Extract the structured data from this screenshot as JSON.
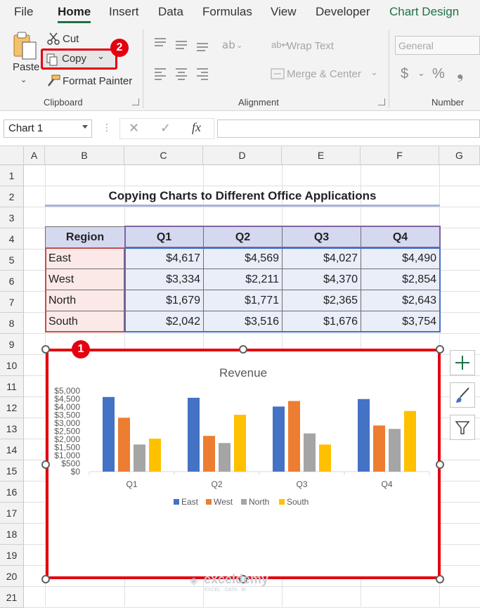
{
  "tabs": [
    "File",
    "Home",
    "Insert",
    "Data",
    "Formulas",
    "View",
    "Developer",
    "Chart Design"
  ],
  "clipboard": {
    "paste": "Paste",
    "cut": "Cut",
    "copy": "Copy",
    "format_painter": "Format Painter",
    "group_label": "Clipboard"
  },
  "alignment": {
    "wrap_text": "Wrap Text",
    "merge_center": "Merge & Center",
    "group_label": "Alignment"
  },
  "number": {
    "format": "General",
    "currency": "$",
    "percent": "%",
    "comma": "❟",
    "group_label": "Number"
  },
  "formula_bar": {
    "name_box": "Chart 1",
    "fx": "fx",
    "value": ""
  },
  "columns": [
    "A",
    "B",
    "C",
    "D",
    "E",
    "F",
    "G"
  ],
  "rows": [
    "1",
    "2",
    "3",
    "4",
    "5",
    "6",
    "7",
    "8",
    "9",
    "10",
    "11",
    "12",
    "13",
    "14",
    "15",
    "16",
    "17",
    "18",
    "19",
    "20",
    "21"
  ],
  "sheet": {
    "title": "Copying Charts to Different Office Applications",
    "headers": [
      "Region",
      "Q1",
      "Q2",
      "Q3",
      "Q4"
    ],
    "rows": [
      [
        "East",
        "$4,617",
        "$4,569",
        "$4,027",
        "$4,490"
      ],
      [
        "West",
        "$3,334",
        "$2,211",
        "$4,370",
        "$2,854"
      ],
      [
        "North",
        "$1,679",
        "$1,771",
        "$2,365",
        "$2,643"
      ],
      [
        "South",
        "$2,042",
        "$3,516",
        "$1,676",
        "$3,754"
      ]
    ]
  },
  "badges": {
    "one": "1",
    "two": "2"
  },
  "watermark": {
    "name": "exceldemy",
    "tagline": "EXCEL · DATA · BI"
  },
  "chart_data": {
    "type": "bar",
    "title": "Revenue",
    "categories": [
      "Q1",
      "Q2",
      "Q3",
      "Q4"
    ],
    "series": [
      {
        "name": "East",
        "color": "#4472c4",
        "values": [
          4617,
          4569,
          4027,
          4490
        ]
      },
      {
        "name": "West",
        "color": "#ed7d31",
        "values": [
          3334,
          2211,
          4370,
          2854
        ]
      },
      {
        "name": "North",
        "color": "#a5a5a5",
        "values": [
          1679,
          1771,
          2365,
          2643
        ]
      },
      {
        "name": "South",
        "color": "#ffc000",
        "values": [
          2042,
          3516,
          1676,
          3754
        ]
      }
    ],
    "ylim": [
      0,
      5000
    ],
    "yticks": [
      "$0",
      "$500",
      "$1,000",
      "$1,500",
      "$2,000",
      "$2,500",
      "$3,000",
      "$3,500",
      "$4,000",
      "$4,500",
      "$5,000"
    ],
    "grid": false,
    "legend_position": "bottom"
  },
  "colors": {
    "accent": "#1e7145",
    "highlight": "#e3000f"
  }
}
